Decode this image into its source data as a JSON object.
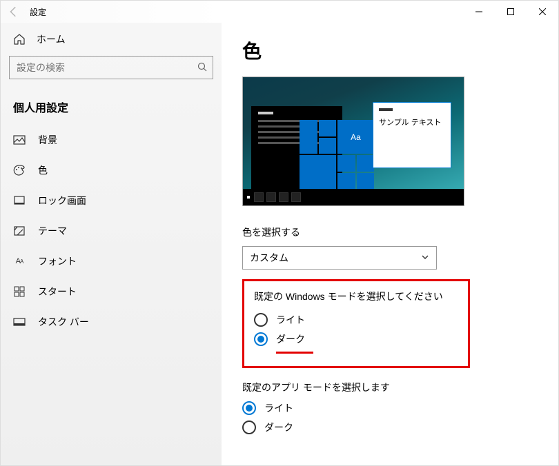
{
  "titlebar": {
    "app_title": "設定"
  },
  "sidebar": {
    "home_label": "ホーム",
    "search_placeholder": "設定の検索",
    "section_head": "個人用設定",
    "items": [
      {
        "label": "背景"
      },
      {
        "label": "色"
      },
      {
        "label": "ロック画面"
      },
      {
        "label": "テーマ"
      },
      {
        "label": "フォント"
      },
      {
        "label": "スタート"
      },
      {
        "label": "タスク バー"
      }
    ]
  },
  "main": {
    "page_title": "色",
    "preview_sample_text": "サンプル テキスト",
    "preview_tile_aa": "Aa",
    "color_section_label": "色を選択する",
    "color_select_value": "カスタム",
    "windows_mode": {
      "label": "既定の Windows モードを選択してください",
      "options": {
        "light": "ライト",
        "dark": "ダーク"
      },
      "selected": "dark"
    },
    "app_mode": {
      "label": "既定のアプリ モードを選択します",
      "options": {
        "light": "ライト",
        "dark": "ダーク"
      },
      "selected": "light"
    }
  }
}
